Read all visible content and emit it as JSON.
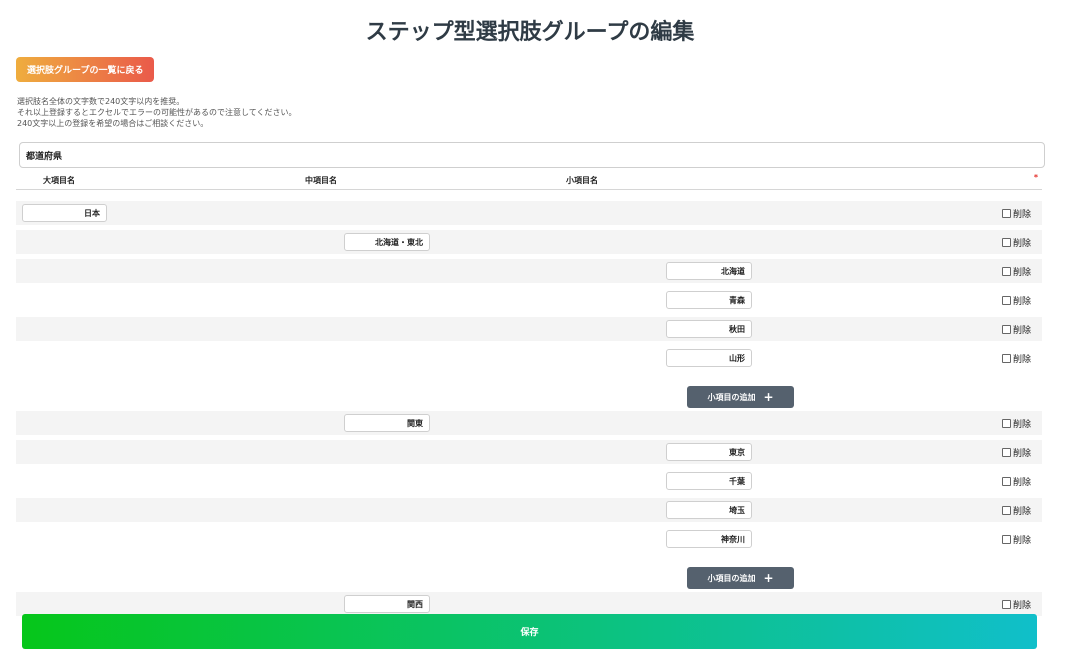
{
  "page": {
    "title": "ステップ型選択肢グループの編集",
    "back_button_label": "選択肢グループの一覧に戻る",
    "notice_lines": [
      "選択肢名全体の文字数で240文字以内を推奨。",
      "それ以上登録するとエクセルでエラーの可能性があるので注意してください。",
      "240文字以上の登録を希望の場合はご相談ください。"
    ],
    "group_name": "都道府県",
    "save_label": "保存"
  },
  "columns": {
    "large": "大項目名",
    "medium": "中項目名",
    "small": "小項目名",
    "required_mark": "*"
  },
  "rows": [
    {
      "level": 1,
      "value": "日本",
      "delete_label": "削除"
    },
    {
      "level": 2,
      "value": "北海道・東北",
      "delete_label": "削除"
    },
    {
      "level": 3,
      "value": "北海道",
      "delete_label": "削除"
    },
    {
      "level": 3,
      "value": "青森",
      "delete_label": "削除"
    },
    {
      "level": 3,
      "value": "秋田",
      "delete_label": "削除"
    },
    {
      "level": 3,
      "value": "山形",
      "delete_label": "削除"
    },
    {
      "level": 2,
      "value": "関東",
      "delete_label": "削除"
    },
    {
      "level": 3,
      "value": "東京",
      "delete_label": "削除"
    },
    {
      "level": 3,
      "value": "千葉",
      "delete_label": "削除"
    },
    {
      "level": 3,
      "value": "埼玉",
      "delete_label": "削除"
    },
    {
      "level": 3,
      "value": "神奈川",
      "delete_label": "削除"
    },
    {
      "level": 2,
      "value": "関西",
      "delete_label": "削除"
    }
  ],
  "add_small_label": "小項目の追加",
  "add_icon": "+",
  "colors": {
    "back_gradient": [
      "#efad3e",
      "#ea5a4a"
    ],
    "save_gradient": [
      "#06c61a",
      "#10bfca"
    ],
    "add_button": "#55616e",
    "required": "#e5322d"
  }
}
